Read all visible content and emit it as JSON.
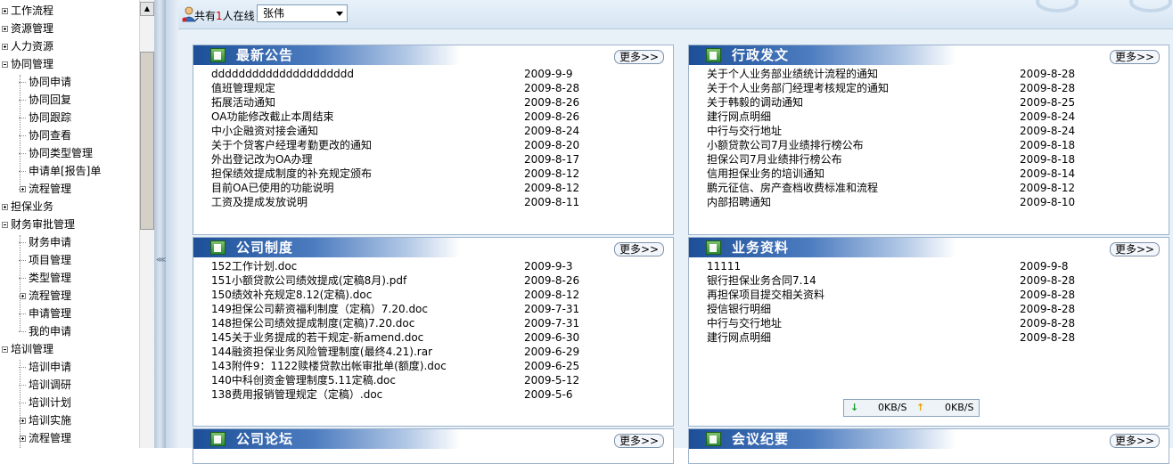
{
  "tree": {
    "items": [
      {
        "label": "工作流程",
        "level": 0,
        "expander": "plus"
      },
      {
        "label": "资源管理",
        "level": 0,
        "expander": "plus"
      },
      {
        "label": "人力资源",
        "level": 0,
        "expander": "plus"
      },
      {
        "label": "协同管理",
        "level": 0,
        "expander": "minus"
      },
      {
        "label": "协同申请",
        "level": 1,
        "expander": "none"
      },
      {
        "label": "协同回复",
        "level": 1,
        "expander": "none"
      },
      {
        "label": "协同跟踪",
        "level": 1,
        "expander": "none"
      },
      {
        "label": "协同查看",
        "level": 1,
        "expander": "none"
      },
      {
        "label": "协同类型管理",
        "level": 1,
        "expander": "none"
      },
      {
        "label": "申请单[报告]单",
        "level": 1,
        "expander": "none"
      },
      {
        "label": "流程管理",
        "level": 1,
        "expander": "plus"
      },
      {
        "label": "担保业务",
        "level": 0,
        "expander": "plus"
      },
      {
        "label": "财务审批管理",
        "level": 0,
        "expander": "minus"
      },
      {
        "label": "财务申请",
        "level": 1,
        "expander": "none"
      },
      {
        "label": "项目管理",
        "level": 1,
        "expander": "none"
      },
      {
        "label": "类型管理",
        "level": 1,
        "expander": "none"
      },
      {
        "label": "流程管理",
        "level": 1,
        "expander": "plus"
      },
      {
        "label": "申请管理",
        "level": 1,
        "expander": "none"
      },
      {
        "label": "我的申请",
        "level": 1,
        "expander": "none"
      },
      {
        "label": "培训管理",
        "level": 0,
        "expander": "minus"
      },
      {
        "label": "培训申请",
        "level": 1,
        "expander": "none"
      },
      {
        "label": "培训调研",
        "level": 1,
        "expander": "none"
      },
      {
        "label": "培训计划",
        "level": 1,
        "expander": "none"
      },
      {
        "label": "培训实施",
        "level": 1,
        "expander": "plus"
      },
      {
        "label": "流程管理",
        "level": 1,
        "expander": "plus"
      }
    ],
    "scroll_up_icon": "▲",
    "grip_icon": "⋘"
  },
  "topbar": {
    "online_prefix": "共有",
    "online_count": "1",
    "online_suffix": "人在线",
    "selected_user": "张伟"
  },
  "panels": [
    {
      "id": "latest-notice",
      "title": "最新公告",
      "more": "更多>>",
      "rows": [
        {
          "title": "ddddddddddddddddddddd",
          "date": "2009-9-9"
        },
        {
          "title": "值班管理规定",
          "date": "2009-8-28"
        },
        {
          "title": "拓展活动通知",
          "date": "2009-8-26"
        },
        {
          "title": "OA功能修改截止本周结束",
          "date": "2009-8-26"
        },
        {
          "title": "中小企融资对接会通知",
          "date": "2009-8-24"
        },
        {
          "title": "关于个贷客户经理考勤更改的通知",
          "date": "2009-8-20"
        },
        {
          "title": "外出登记改为OA办理",
          "date": "2009-8-17"
        },
        {
          "title": "担保绩效提成制度的补充规定颁布",
          "date": "2009-8-12"
        },
        {
          "title": "目前OA已使用的功能说明",
          "date": "2009-8-12"
        },
        {
          "title": "工资及提成发放说明",
          "date": "2009-8-11"
        }
      ]
    },
    {
      "id": "admin-dispatch",
      "title": "行政发文",
      "more": "更多>>",
      "rows": [
        {
          "title": "关于个人业务部业绩统计流程的通知",
          "date": "2009-8-28"
        },
        {
          "title": "关于个人业务部门经理考核规定的通知",
          "date": "2009-8-28"
        },
        {
          "title": "关于韩毅的调动通知",
          "date": "2009-8-25"
        },
        {
          "title": "建行网点明细",
          "date": "2009-8-24"
        },
        {
          "title": "中行与交行地址",
          "date": "2009-8-24"
        },
        {
          "title": "小额贷款公司7月业绩排行榜公布",
          "date": "2009-8-18"
        },
        {
          "title": "担保公司7月业绩排行榜公布",
          "date": "2009-8-18"
        },
        {
          "title": "信用担保业务的培训通知",
          "date": "2009-8-14"
        },
        {
          "title": "鹏元征信、房产查档收费标准和流程",
          "date": "2009-8-12"
        },
        {
          "title": "内部招聘通知",
          "date": "2009-8-10"
        }
      ]
    },
    {
      "id": "company-rules",
      "title": "公司制度",
      "more": "更多>>",
      "rows": [
        {
          "title": "152工作计划.doc",
          "date": "2009-9-3"
        },
        {
          "title": "151小额贷款公司绩效提成(定稿8月).pdf",
          "date": "2009-8-26"
        },
        {
          "title": "150绩效补充规定8.12(定稿).doc",
          "date": "2009-8-12"
        },
        {
          "title": "149担保公司薪资福利制度（定稿）7.20.doc",
          "date": "2009-7-31"
        },
        {
          "title": "148担保公司绩效提成制度(定稿)7.20.doc",
          "date": "2009-7-31"
        },
        {
          "title": "145关于业务提成的若干规定-新amend.doc",
          "date": "2009-6-30"
        },
        {
          "title": "144融资担保业务风险管理制度(最终4.21).rar",
          "date": "2009-6-29"
        },
        {
          "title": "143附件9：1122赎楼贷款出帐审批单(额度).doc",
          "date": "2009-6-25"
        },
        {
          "title": "140中科创资金管理制度5.11定稿.doc",
          "date": "2009-5-12"
        },
        {
          "title": "138费用报销管理规定（定稿）.doc",
          "date": "2009-5-6"
        }
      ]
    },
    {
      "id": "business-materials",
      "title": "业务资料",
      "more": "更多>>",
      "rows": [
        {
          "title": "11111",
          "date": "2009-9-8"
        },
        {
          "title": "银行担保业务合同7.14",
          "date": "2009-8-28"
        },
        {
          "title": "再担保项目提交相关资料",
          "date": "2009-8-28"
        },
        {
          "title": "授信银行明细",
          "date": "2009-8-28"
        },
        {
          "title": "中行与交行地址",
          "date": "2009-8-28"
        },
        {
          "title": "建行网点明细",
          "date": "2009-8-28"
        }
      ]
    },
    {
      "id": "company-forum",
      "title": "公司论坛",
      "more": "更多>>",
      "rows": []
    },
    {
      "id": "meeting-minutes",
      "title": "会议纪要",
      "more": "更多>>",
      "rows": []
    }
  ],
  "speed": {
    "down_icon": "↓",
    "down_value": "0KB/S",
    "up_icon": "↑",
    "up_value": "0KB/S",
    "down_color": "#1a9a2a",
    "up_color": "#e8a200"
  }
}
